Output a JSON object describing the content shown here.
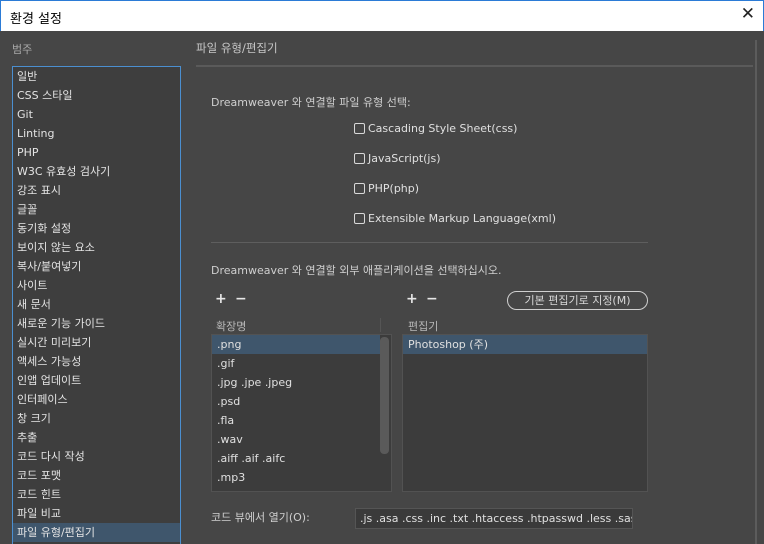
{
  "window": {
    "title": "환경 설정",
    "close": "✕"
  },
  "sidebar": {
    "label": "범주",
    "items": [
      "일반",
      "CSS 스타일",
      "Git",
      "Linting",
      "PHP",
      "W3C 유효성 검사기",
      "강조 표시",
      "글꼴",
      "동기화 설정",
      "보이지 않는 요소",
      "복사/붙여넣기",
      "사이트",
      "새 문서",
      "새로운 기능 가이드",
      "실시간 미리보기",
      "액세스 가능성",
      "인앱 업데이트",
      "인터페이스",
      "창 크기",
      "추출",
      "코드 다시 작성",
      "코드 포맷",
      "코드 힌트",
      "파일 비교",
      "파일 유형/편집기"
    ],
    "selected_index": 24
  },
  "main": {
    "title": "파일 유형/편집기",
    "assoc_label": "Dreamweaver 와 연결할 파일 유형 선택:",
    "checkboxes": [
      {
        "label": "Cascading Style Sheet(css)",
        "checked": false
      },
      {
        "label": "JavaScript(js)",
        "checked": false
      },
      {
        "label": "PHP(php)",
        "checked": false
      },
      {
        "label": "Extensible Markup Language(xml)",
        "checked": false
      }
    ],
    "external_label": "Dreamweaver 와 연결할 외부 애플리케이션을 선택하십시오.",
    "plus": "+",
    "minus": "−",
    "default_button": "기본 편집기로 지정(M)",
    "ext_header": "확장명",
    "editor_header": "편집기",
    "extensions": [
      ".png",
      ".gif",
      ".jpg .jpe .jpeg",
      ".psd",
      ".fla",
      ".wav",
      ".aiff .aif .aifc",
      ".mp3"
    ],
    "editors": [
      "Photoshop (주)"
    ],
    "codeview_label": "코드 뷰에서 열기(O):",
    "codeview_value": ".js .asa .css .inc .txt .htaccess .htpasswd .less .sass .scss"
  }
}
